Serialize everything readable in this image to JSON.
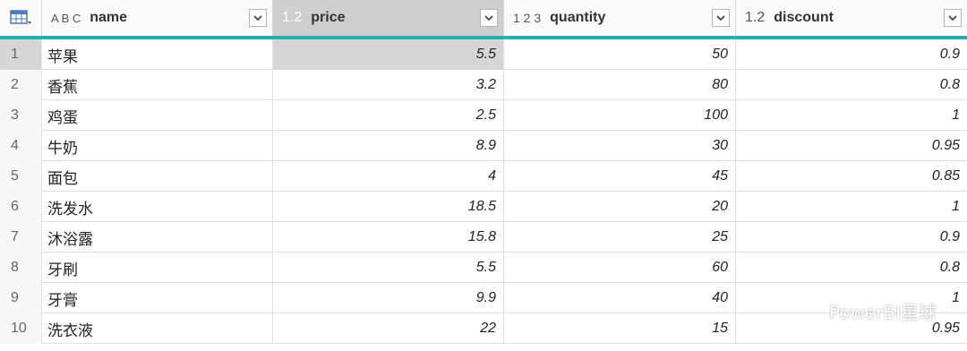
{
  "header": {
    "table_menu_icon": "table-icon",
    "columns": [
      {
        "type_label": "A B C",
        "name": "name"
      },
      {
        "type_label": "1.2",
        "name": "price"
      },
      {
        "type_label": "1 2 3",
        "name": "quantity"
      },
      {
        "type_label": "1.2",
        "name": "discount"
      }
    ]
  },
  "rows": [
    {
      "index": "1",
      "name": "苹果",
      "price": "5.5",
      "quantity": "50",
      "discount": "0.9"
    },
    {
      "index": "2",
      "name": "香蕉",
      "price": "3.2",
      "quantity": "80",
      "discount": "0.8"
    },
    {
      "index": "3",
      "name": "鸡蛋",
      "price": "2.5",
      "quantity": "100",
      "discount": "1"
    },
    {
      "index": "4",
      "name": "牛奶",
      "price": "8.9",
      "quantity": "30",
      "discount": "0.95"
    },
    {
      "index": "5",
      "name": "面包",
      "price": "4",
      "quantity": "45",
      "discount": "0.85"
    },
    {
      "index": "6",
      "name": "洗发水",
      "price": "18.5",
      "quantity": "20",
      "discount": "1"
    },
    {
      "index": "7",
      "name": "沐浴露",
      "price": "15.8",
      "quantity": "25",
      "discount": "0.9"
    },
    {
      "index": "8",
      "name": "牙刷",
      "price": "5.5",
      "quantity": "60",
      "discount": "0.8"
    },
    {
      "index": "9",
      "name": "牙膏",
      "price": "9.9",
      "quantity": "40",
      "discount": "1"
    },
    {
      "index": "10",
      "name": "洗衣液",
      "price": "22",
      "quantity": "15",
      "discount": "0.95"
    }
  ],
  "watermark": "PowerBI星球",
  "colors": {
    "accent": "#20b2aa",
    "selected": "#cfcfcf"
  }
}
